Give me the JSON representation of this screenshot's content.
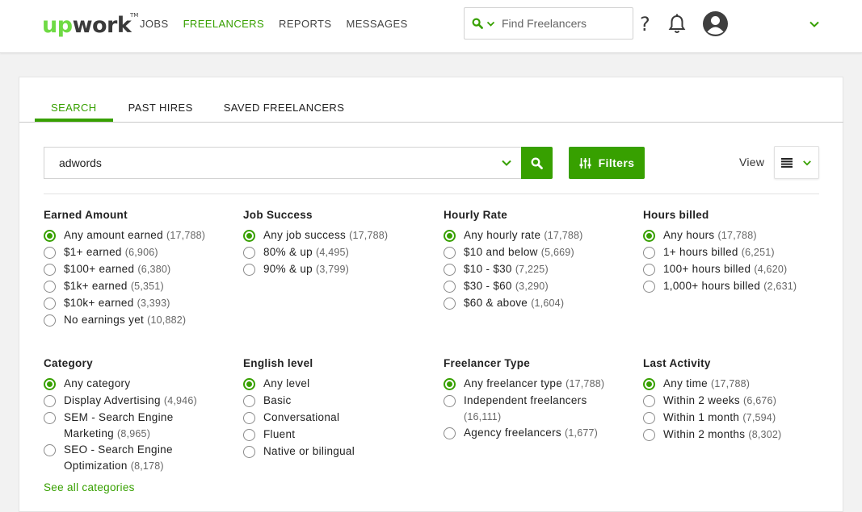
{
  "header": {
    "logo_up": "up",
    "logo_work": "work",
    "logo_tm": "TM",
    "nav": [
      {
        "label": "JOBS",
        "active": false
      },
      {
        "label": "FREELANCERS",
        "active": true
      },
      {
        "label": "REPORTS",
        "active": false
      },
      {
        "label": "MESSAGES",
        "active": false
      }
    ],
    "search_placeholder": "Find Freelancers",
    "help_glyph": "?"
  },
  "tabs": [
    {
      "label": "SEARCH",
      "active": true
    },
    {
      "label": "PAST HIRES",
      "active": false
    },
    {
      "label": "SAVED FREELANCERS",
      "active": false
    }
  ],
  "query": {
    "value": "adwords"
  },
  "toolbar": {
    "filters_label": "Filters",
    "view_label": "View"
  },
  "filter_groups": [
    {
      "title": "Earned Amount",
      "options": [
        {
          "label": "Any amount earned",
          "count": "(17,788)",
          "checked": true
        },
        {
          "label": "$1+ earned",
          "count": "(6,906)",
          "checked": false
        },
        {
          "label": "$100+ earned",
          "count": "(6,380)",
          "checked": false
        },
        {
          "label": "$1k+ earned",
          "count": "(5,351)",
          "checked": false
        },
        {
          "label": "$10k+ earned",
          "count": "(3,393)",
          "checked": false
        },
        {
          "label": "No earnings yet",
          "count": "(10,882)",
          "checked": false
        }
      ]
    },
    {
      "title": "Job Success",
      "options": [
        {
          "label": "Any job success",
          "count": "(17,788)",
          "checked": true
        },
        {
          "label": "80% & up",
          "count": "(4,495)",
          "checked": false
        },
        {
          "label": "90% & up",
          "count": "(3,799)",
          "checked": false
        }
      ]
    },
    {
      "title": "Hourly Rate",
      "options": [
        {
          "label": "Any hourly rate",
          "count": "(17,788)",
          "checked": true
        },
        {
          "label": "$10 and below",
          "count": "(5,669)",
          "checked": false
        },
        {
          "label": "$10 - $30",
          "count": "(7,225)",
          "checked": false
        },
        {
          "label": "$30 - $60",
          "count": "(3,290)",
          "checked": false
        },
        {
          "label": "$60 & above",
          "count": "(1,604)",
          "checked": false
        }
      ]
    },
    {
      "title": "Hours billed",
      "options": [
        {
          "label": "Any hours",
          "count": "(17,788)",
          "checked": true
        },
        {
          "label": "1+ hours billed",
          "count": "(6,251)",
          "checked": false
        },
        {
          "label": "100+ hours billed",
          "count": "(4,620)",
          "checked": false
        },
        {
          "label": "1,000+ hours billed",
          "count": "(2,631)",
          "checked": false
        }
      ]
    },
    {
      "title": "Category",
      "options": [
        {
          "label": "Any category",
          "count": "",
          "checked": true
        },
        {
          "label": "Display Advertising",
          "count": "(4,946)",
          "checked": false
        },
        {
          "label": "SEM - Search Engine Marketing",
          "count": "(8,965)",
          "checked": false
        },
        {
          "label": "SEO - Search Engine Optimization",
          "count": "(8,178)",
          "checked": false
        }
      ]
    },
    {
      "title": "English level",
      "options": [
        {
          "label": "Any level",
          "count": "",
          "checked": true
        },
        {
          "label": "Basic",
          "count": "",
          "checked": false
        },
        {
          "label": "Conversational",
          "count": "",
          "checked": false
        },
        {
          "label": "Fluent",
          "count": "",
          "checked": false
        },
        {
          "label": "Native or bilingual",
          "count": "",
          "checked": false
        }
      ]
    },
    {
      "title": "Freelancer Type",
      "options": [
        {
          "label": "Any freelancer type",
          "count": "(17,788)",
          "checked": true
        },
        {
          "label": "Independent freelancers",
          "count": "(16,111)",
          "checked": false
        },
        {
          "label": "Agency freelancers",
          "count": "(1,677)",
          "checked": false
        }
      ]
    },
    {
      "title": "Last Activity",
      "options": [
        {
          "label": "Any time",
          "count": "(17,788)",
          "checked": true
        },
        {
          "label": "Within 2 weeks",
          "count": "(6,676)",
          "checked": false
        },
        {
          "label": "Within 1 month",
          "count": "(7,594)",
          "checked": false
        },
        {
          "label": "Within 2 months",
          "count": "(8,302)",
          "checked": false
        }
      ]
    }
  ],
  "see_all_categories": "See all categories",
  "colors": {
    "brand_green": "#37a000",
    "logo_green": "#6fda44"
  },
  "icons": [
    "search-icon",
    "chevron-down-icon",
    "help-icon",
    "bell-icon",
    "user-avatar-icon",
    "filters-sliders-icon",
    "list-view-icon"
  ]
}
